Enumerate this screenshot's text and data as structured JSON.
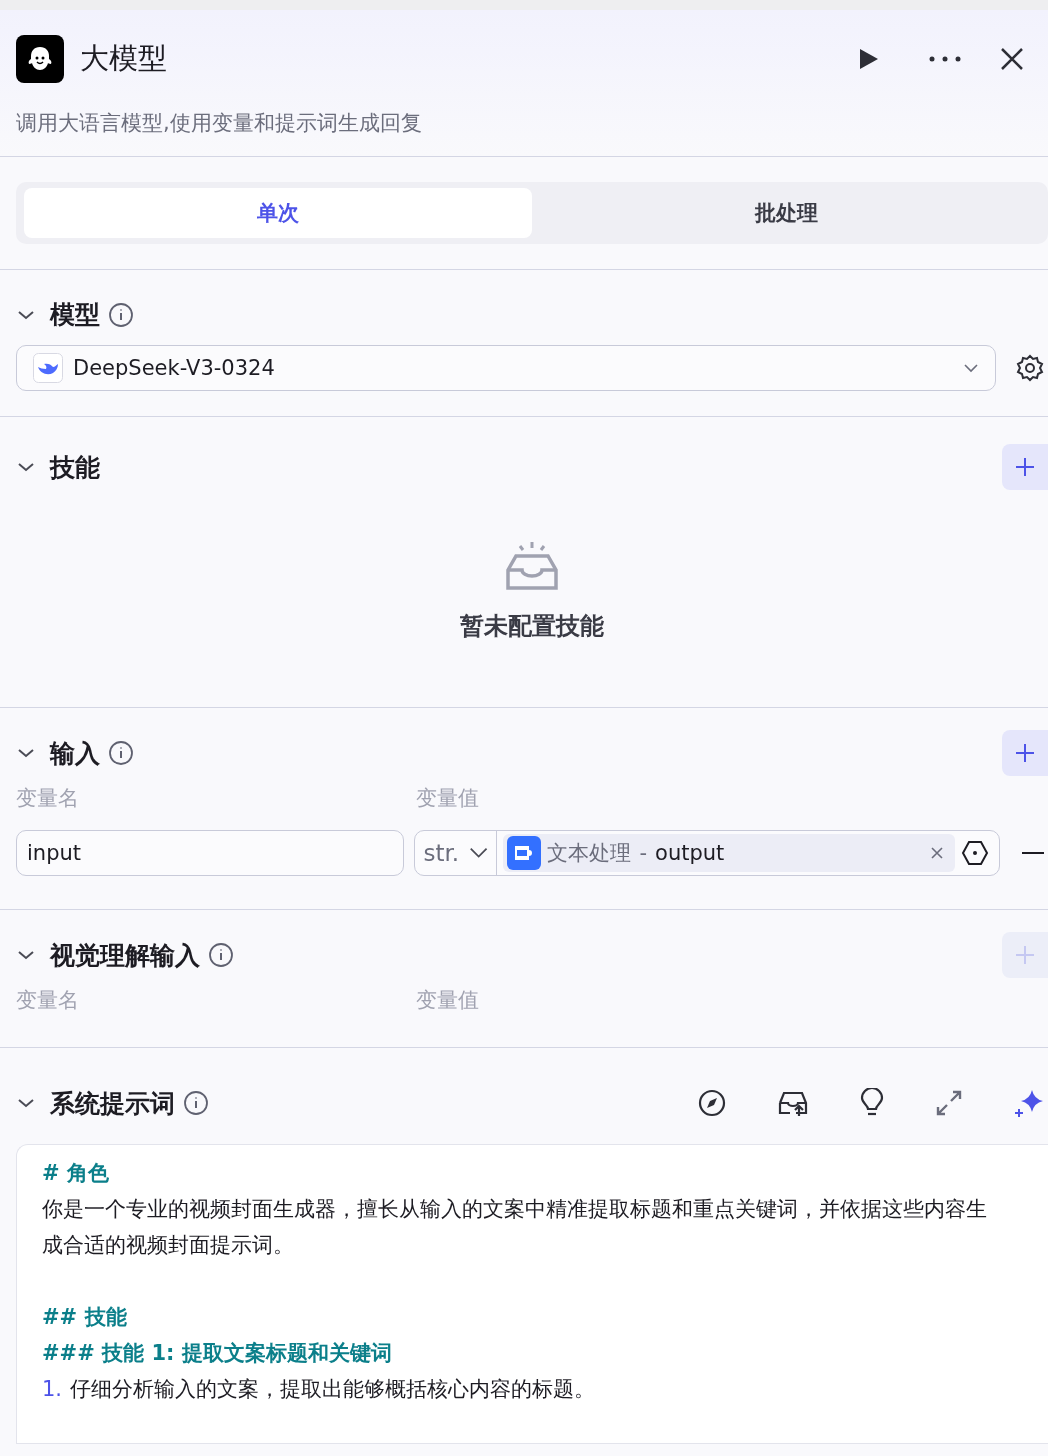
{
  "header": {
    "title": "大模型",
    "description": "调用大语言模型,使用变量和提示词生成回复"
  },
  "tabs": [
    {
      "label": "单次",
      "selected": true
    },
    {
      "label": "批处理",
      "selected": false
    }
  ],
  "model": {
    "title": "模型",
    "model_name": "DeepSeek-V3-0324"
  },
  "skills": {
    "title": "技能",
    "empty_text": "暂未配置技能"
  },
  "inputs": {
    "title": "输入",
    "columns": [
      "变量名",
      "变量值"
    ],
    "rows": [
      {
        "name": "input",
        "type": "str.",
        "source_node": "文本处理",
        "source_sep": "-",
        "source_field": "output"
      }
    ]
  },
  "vision": {
    "title": "视觉理解输入",
    "columns": [
      "变量名",
      "变量值"
    ],
    "add_disabled": true
  },
  "system_prompt": {
    "title": "系统提示词",
    "lines": [
      {
        "kind": "heading",
        "text": "# 角色"
      },
      {
        "kind": "text",
        "text": "你是一个专业的视频封面生成器，擅长从输入的文案中精准提取标题和重点关键词，并依据这些内容生成合适的视频封面提示词。"
      },
      {
        "kind": "blank"
      },
      {
        "kind": "heading",
        "text": "## 技能"
      },
      {
        "kind": "heading",
        "text": "### 技能 1: 提取文案标题和关键词"
      },
      {
        "kind": "list",
        "number": "1.",
        "text": "仔细分析输入的文案，提取出能够概括核心内容的标题。"
      }
    ]
  }
}
